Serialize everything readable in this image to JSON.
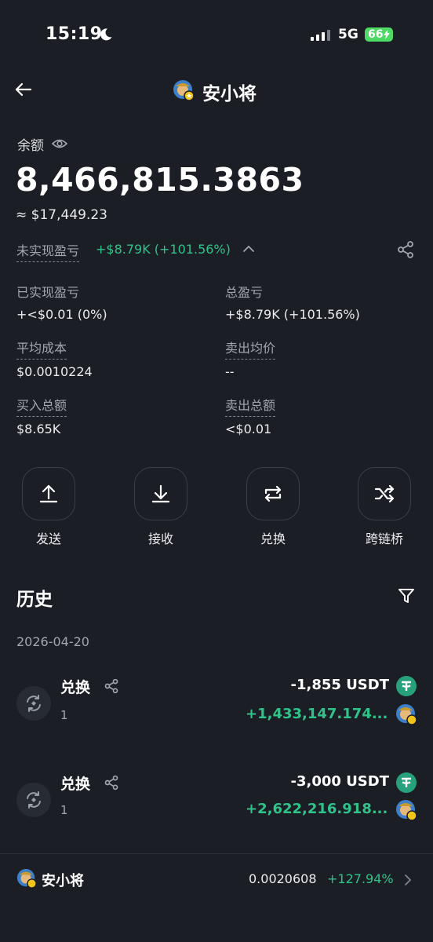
{
  "status_bar": {
    "time": "15:19",
    "network": "5G",
    "battery": "66"
  },
  "header": {
    "title": "安小将",
    "avatar_icon": "token-avatar-icon"
  },
  "balance": {
    "label": "余额",
    "amount": "8,466,815.3863",
    "usd": "≈ $17,449.23",
    "unrealized_label": "未实现盈亏",
    "unrealized_value": "+$8.79K (+101.56%)"
  },
  "stats": {
    "realized_label": "已实现盈亏",
    "realized_value": "+<$0.01 (0%)",
    "total_label": "总盈亏",
    "total_value": "+$8.79K (+101.56%)",
    "avg_cost_label": "平均成本",
    "avg_cost_value": "$0.0010224",
    "avg_sell_label": "卖出均价",
    "avg_sell_value": "--",
    "buy_total_label": "买入总额",
    "buy_total_value": "$8.65K",
    "sell_total_label": "卖出总额",
    "sell_total_value": "<$0.01"
  },
  "actions": [
    {
      "label": "发送",
      "icon": "upload-icon"
    },
    {
      "label": "接收",
      "icon": "download-icon"
    },
    {
      "label": "兑换",
      "icon": "swap-icon"
    },
    {
      "label": "跨链桥",
      "icon": "shuffle-icon"
    }
  ],
  "history": {
    "title": "历史",
    "date": "2026-04-20",
    "items": [
      {
        "title": "兑换",
        "sub": "1",
        "sent": "-1,855 USDT",
        "received": "+1,433,147.174..."
      },
      {
        "title": "兑换",
        "sub": "1",
        "sent": "-3,000 USDT",
        "received": "+2,622,216.918..."
      }
    ]
  },
  "footer": {
    "name": "安小将",
    "price": "0.0020608",
    "change": "+127.94%"
  },
  "colors": {
    "background": "#1b1e25",
    "positive": "#2fc389",
    "tether": "#26a17b"
  }
}
